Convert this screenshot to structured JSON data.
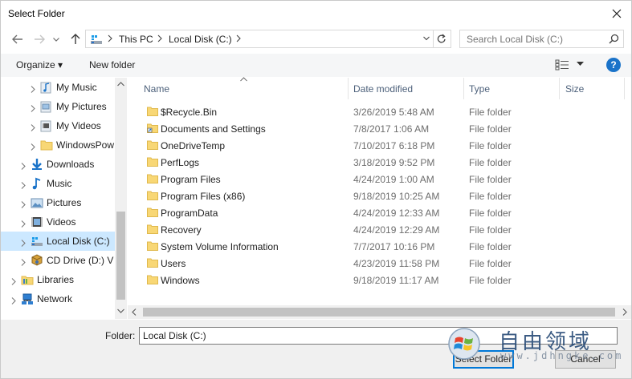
{
  "window": {
    "title": "Select Folder"
  },
  "address": {
    "crumbs": [
      "This PC",
      "Local Disk (C:)"
    ]
  },
  "search": {
    "placeholder": "Search Local Disk (C:)"
  },
  "toolbar": {
    "organize": "Organize",
    "organize_arrow": "▾",
    "new_folder": "New folder",
    "help": "?"
  },
  "nav": {
    "items": [
      {
        "label": "My Music",
        "icon": "music-folder-icon"
      },
      {
        "label": "My Pictures",
        "icon": "pictures-folder-icon"
      },
      {
        "label": "My Videos",
        "icon": "videos-folder-icon"
      },
      {
        "label": "WindowsPow",
        "icon": "folder-icon"
      },
      {
        "label": "Downloads",
        "icon": "downloads-icon"
      },
      {
        "label": "Music",
        "icon": "music-icon"
      },
      {
        "label": "Pictures",
        "icon": "pictures-icon"
      },
      {
        "label": "Videos",
        "icon": "videos-icon"
      },
      {
        "label": "Local Disk (C:)",
        "icon": "drive-icon",
        "selected": true
      },
      {
        "label": "CD Drive (D:) V",
        "icon": "cd-drive-icon"
      },
      {
        "label": "Libraries",
        "icon": "libraries-icon"
      },
      {
        "label": "Network",
        "icon": "network-icon"
      }
    ]
  },
  "columns": {
    "name": "Name",
    "date": "Date modified",
    "type": "Type",
    "size": "Size"
  },
  "files": [
    {
      "name": "$Recycle.Bin",
      "date": "3/26/2019 5:48 AM",
      "type": "File folder"
    },
    {
      "name": "Documents and Settings",
      "date": "7/8/2017 1:06 AM",
      "type": "File folder"
    },
    {
      "name": "OneDriveTemp",
      "date": "7/10/2017 6:18 PM",
      "type": "File folder"
    },
    {
      "name": "PerfLogs",
      "date": "3/18/2019 9:52 PM",
      "type": "File folder"
    },
    {
      "name": "Program Files",
      "date": "4/24/2019 1:00 AM",
      "type": "File folder"
    },
    {
      "name": "Program Files (x86)",
      "date": "9/18/2019 10:25 AM",
      "type": "File folder"
    },
    {
      "name": "ProgramData",
      "date": "4/24/2019 12:33 AM",
      "type": "File folder"
    },
    {
      "name": "Recovery",
      "date": "4/24/2019 12:29 AM",
      "type": "File folder"
    },
    {
      "name": "System Volume Information",
      "date": "7/7/2017 10:16 PM",
      "type": "File folder"
    },
    {
      "name": "Users",
      "date": "4/23/2019 11:58 PM",
      "type": "File folder"
    },
    {
      "name": "Windows",
      "date": "9/18/2019 11:17 AM",
      "type": "File folder"
    }
  ],
  "footer": {
    "folder_label": "Folder:",
    "folder_value": "Local Disk (C:)",
    "select_button": "Select Folder",
    "cancel_button": "Cancel"
  },
  "watermark": {
    "text": "自由领域",
    "url": "www.jdhngke.com"
  },
  "colors": {
    "accent": "#0078d7",
    "selection": "#cce8ff",
    "folder": "#f8d775"
  }
}
